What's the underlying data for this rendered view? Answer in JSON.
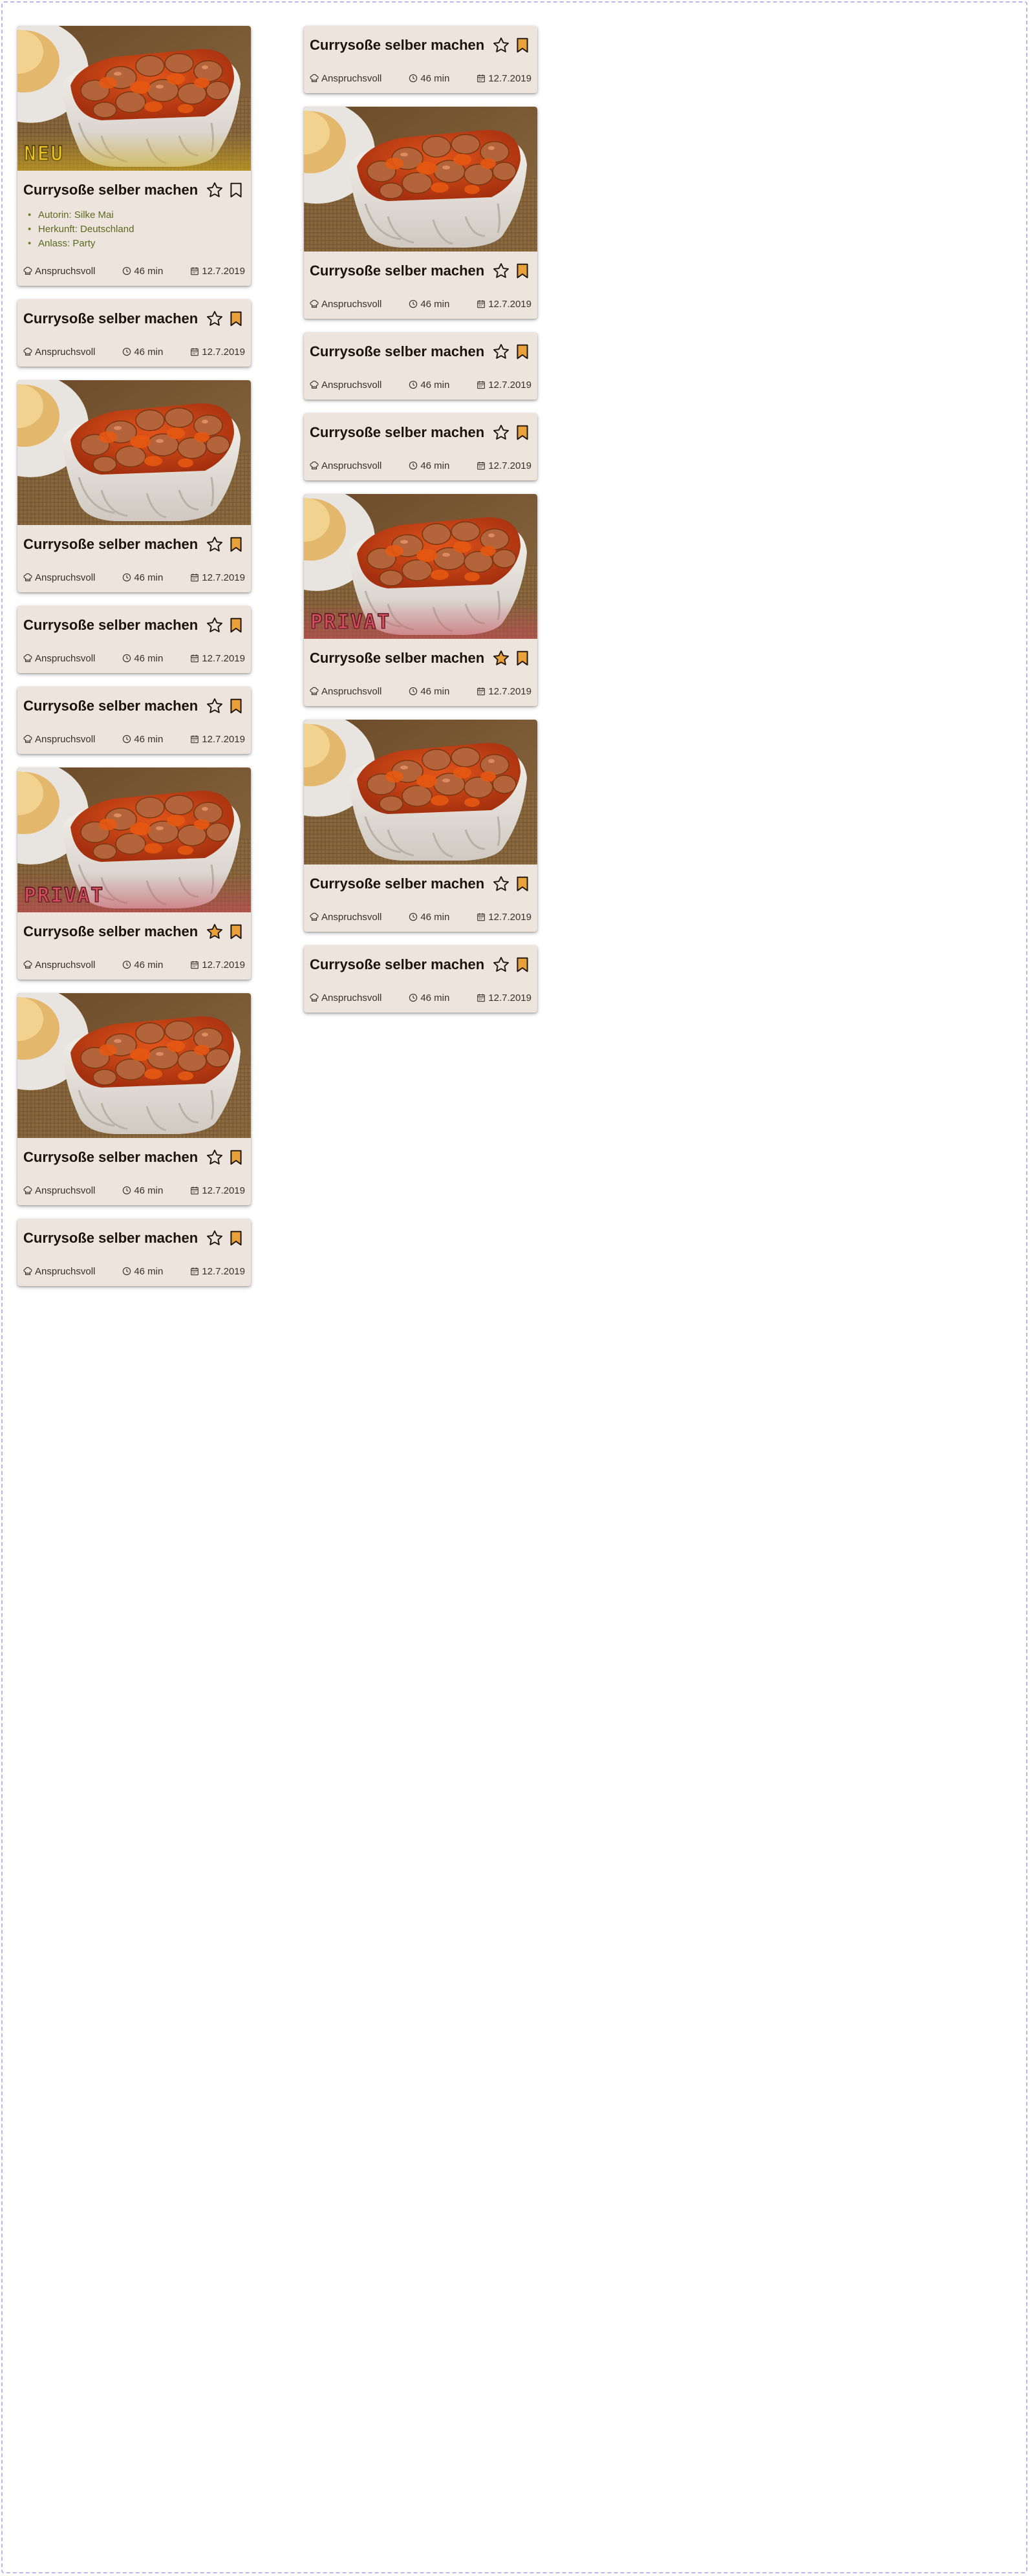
{
  "colors": {
    "card_background": "#ede5dd",
    "star_active": "#e9a23b",
    "bookmark_active": "#e9a23b",
    "detail_text": "#5a6a1e",
    "badge_new": "#f3ca24",
    "badge_private": "#d9555f"
  },
  "icons": {
    "favorite": "star-icon",
    "bookmark": "bookmark-icon",
    "difficulty": "chef-hat-icon",
    "duration": "clock-icon",
    "date": "calendar-icon"
  },
  "columns": [
    {
      "cards": [
        {
          "title": "Currysoße selber machen",
          "has_image": true,
          "badge": "NEU",
          "badge_kind": "new",
          "starred": false,
          "bookmarked": false,
          "details": [
            "Autorin: Silke Mai",
            "Herkunft: Deutschland",
            "Anlass: Party"
          ],
          "difficulty": "Anspruchsvoll",
          "duration": "46 min",
          "date": "12.7.2019"
        },
        {
          "title": "Currysoße selber machen",
          "has_image": false,
          "badge": "",
          "badge_kind": "",
          "starred": false,
          "bookmarked": true,
          "details": [],
          "difficulty": "Anspruchsvoll",
          "duration": "46 min",
          "date": "12.7.2019"
        },
        {
          "title": "Currysoße selber machen",
          "has_image": true,
          "badge": "",
          "badge_kind": "",
          "starred": false,
          "bookmarked": true,
          "details": [],
          "difficulty": "Anspruchsvoll",
          "duration": "46 min",
          "date": "12.7.2019"
        },
        {
          "title": "Currysoße selber machen",
          "has_image": false,
          "badge": "",
          "badge_kind": "",
          "starred": false,
          "bookmarked": true,
          "details": [],
          "difficulty": "Anspruchsvoll",
          "duration": "46 min",
          "date": "12.7.2019"
        },
        {
          "title": "Currysoße selber machen",
          "has_image": false,
          "badge": "",
          "badge_kind": "",
          "starred": false,
          "bookmarked": true,
          "details": [],
          "difficulty": "Anspruchsvoll",
          "duration": "46 min",
          "date": "12.7.2019"
        },
        {
          "title": "Currysoße selber machen",
          "has_image": true,
          "badge": "PRIVAT",
          "badge_kind": "private",
          "starred": true,
          "bookmarked": true,
          "details": [],
          "difficulty": "Anspruchsvoll",
          "duration": "46 min",
          "date": "12.7.2019"
        },
        {
          "title": "Currysoße selber machen",
          "has_image": true,
          "badge": "",
          "badge_kind": "",
          "starred": false,
          "bookmarked": true,
          "details": [],
          "difficulty": "Anspruchsvoll",
          "duration": "46 min",
          "date": "12.7.2019"
        },
        {
          "title": "Currysoße selber machen",
          "has_image": false,
          "badge": "",
          "badge_kind": "",
          "starred": false,
          "bookmarked": true,
          "details": [],
          "difficulty": "Anspruchsvoll",
          "duration": "46 min",
          "date": "12.7.2019"
        }
      ]
    },
    {
      "cards": [
        {
          "title": "Currysoße selber machen",
          "has_image": false,
          "badge": "",
          "badge_kind": "",
          "starred": false,
          "bookmarked": true,
          "details": [],
          "difficulty": "Anspruchsvoll",
          "duration": "46 min",
          "date": "12.7.2019"
        },
        {
          "title": "Currysoße selber machen",
          "has_image": true,
          "badge": "",
          "badge_kind": "",
          "starred": false,
          "bookmarked": true,
          "details": [],
          "difficulty": "Anspruchsvoll",
          "duration": "46 min",
          "date": "12.7.2019"
        },
        {
          "title": "Currysoße selber machen",
          "has_image": false,
          "badge": "",
          "badge_kind": "",
          "starred": false,
          "bookmarked": true,
          "details": [],
          "difficulty": "Anspruchsvoll",
          "duration": "46 min",
          "date": "12.7.2019"
        },
        {
          "title": "Currysoße selber machen",
          "has_image": false,
          "badge": "",
          "badge_kind": "",
          "starred": false,
          "bookmarked": true,
          "details": [],
          "difficulty": "Anspruchsvoll",
          "duration": "46 min",
          "date": "12.7.2019"
        },
        {
          "title": "Currysoße selber machen",
          "has_image": true,
          "badge": "PRIVAT",
          "badge_kind": "private",
          "starred": true,
          "bookmarked": true,
          "details": [],
          "difficulty": "Anspruchsvoll",
          "duration": "46 min",
          "date": "12.7.2019"
        },
        {
          "title": "Currysoße selber machen",
          "has_image": true,
          "badge": "",
          "badge_kind": "",
          "starred": false,
          "bookmarked": true,
          "details": [],
          "difficulty": "Anspruchsvoll",
          "duration": "46 min",
          "date": "12.7.2019"
        },
        {
          "title": "Currysoße selber machen",
          "has_image": false,
          "badge": "",
          "badge_kind": "",
          "starred": false,
          "bookmarked": true,
          "details": [],
          "difficulty": "Anspruchsvoll",
          "duration": "46 min",
          "date": "12.7.2019"
        }
      ]
    }
  ]
}
